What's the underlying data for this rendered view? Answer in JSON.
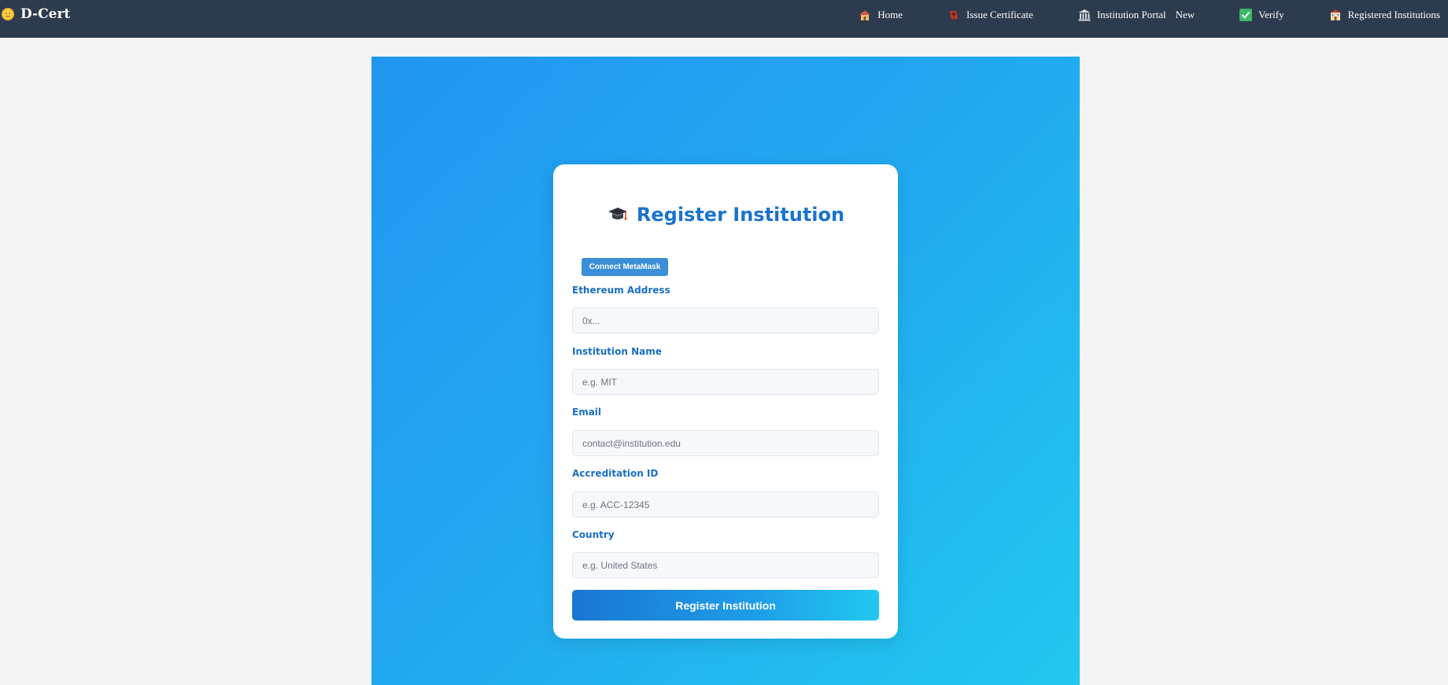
{
  "app": {
    "brand": "D-Cert",
    "brand_icon": "sun-icon"
  },
  "nav": {
    "items": [
      {
        "label": "Home",
        "icon": "house-icon"
      },
      {
        "label": "Issue Certificate",
        "icon": "scroll-icon"
      },
      {
        "label": "Institution Portal",
        "icon": "classical-building-icon",
        "badge": "New"
      },
      {
        "label": "Verify",
        "icon": "check-box-icon"
      },
      {
        "label": "Registered Institutions",
        "icon": "school-icon"
      }
    ]
  },
  "form": {
    "title": "Register Institution",
    "title_icon": "graduation-cap-icon",
    "connect_button": "Connect MetaMask",
    "fields": [
      {
        "label": "Ethereum Address",
        "placeholder": "0x...",
        "value": ""
      },
      {
        "label": "Institution Name",
        "placeholder": "e.g. MIT",
        "value": ""
      },
      {
        "label": "Email",
        "placeholder": "contact@institution.edu",
        "value": ""
      },
      {
        "label": "Accreditation ID",
        "placeholder": "e.g. ACC-12345",
        "value": ""
      },
      {
        "label": "Country",
        "placeholder": "e.g. United States",
        "value": ""
      }
    ],
    "submit_button": "Register Institution"
  },
  "colors": {
    "navbar_bg": "#2d3b4e",
    "accent": "#1a73cc",
    "gradient_start": "#2196f0",
    "gradient_end": "#22c8ef",
    "success": "#3cb96a"
  }
}
